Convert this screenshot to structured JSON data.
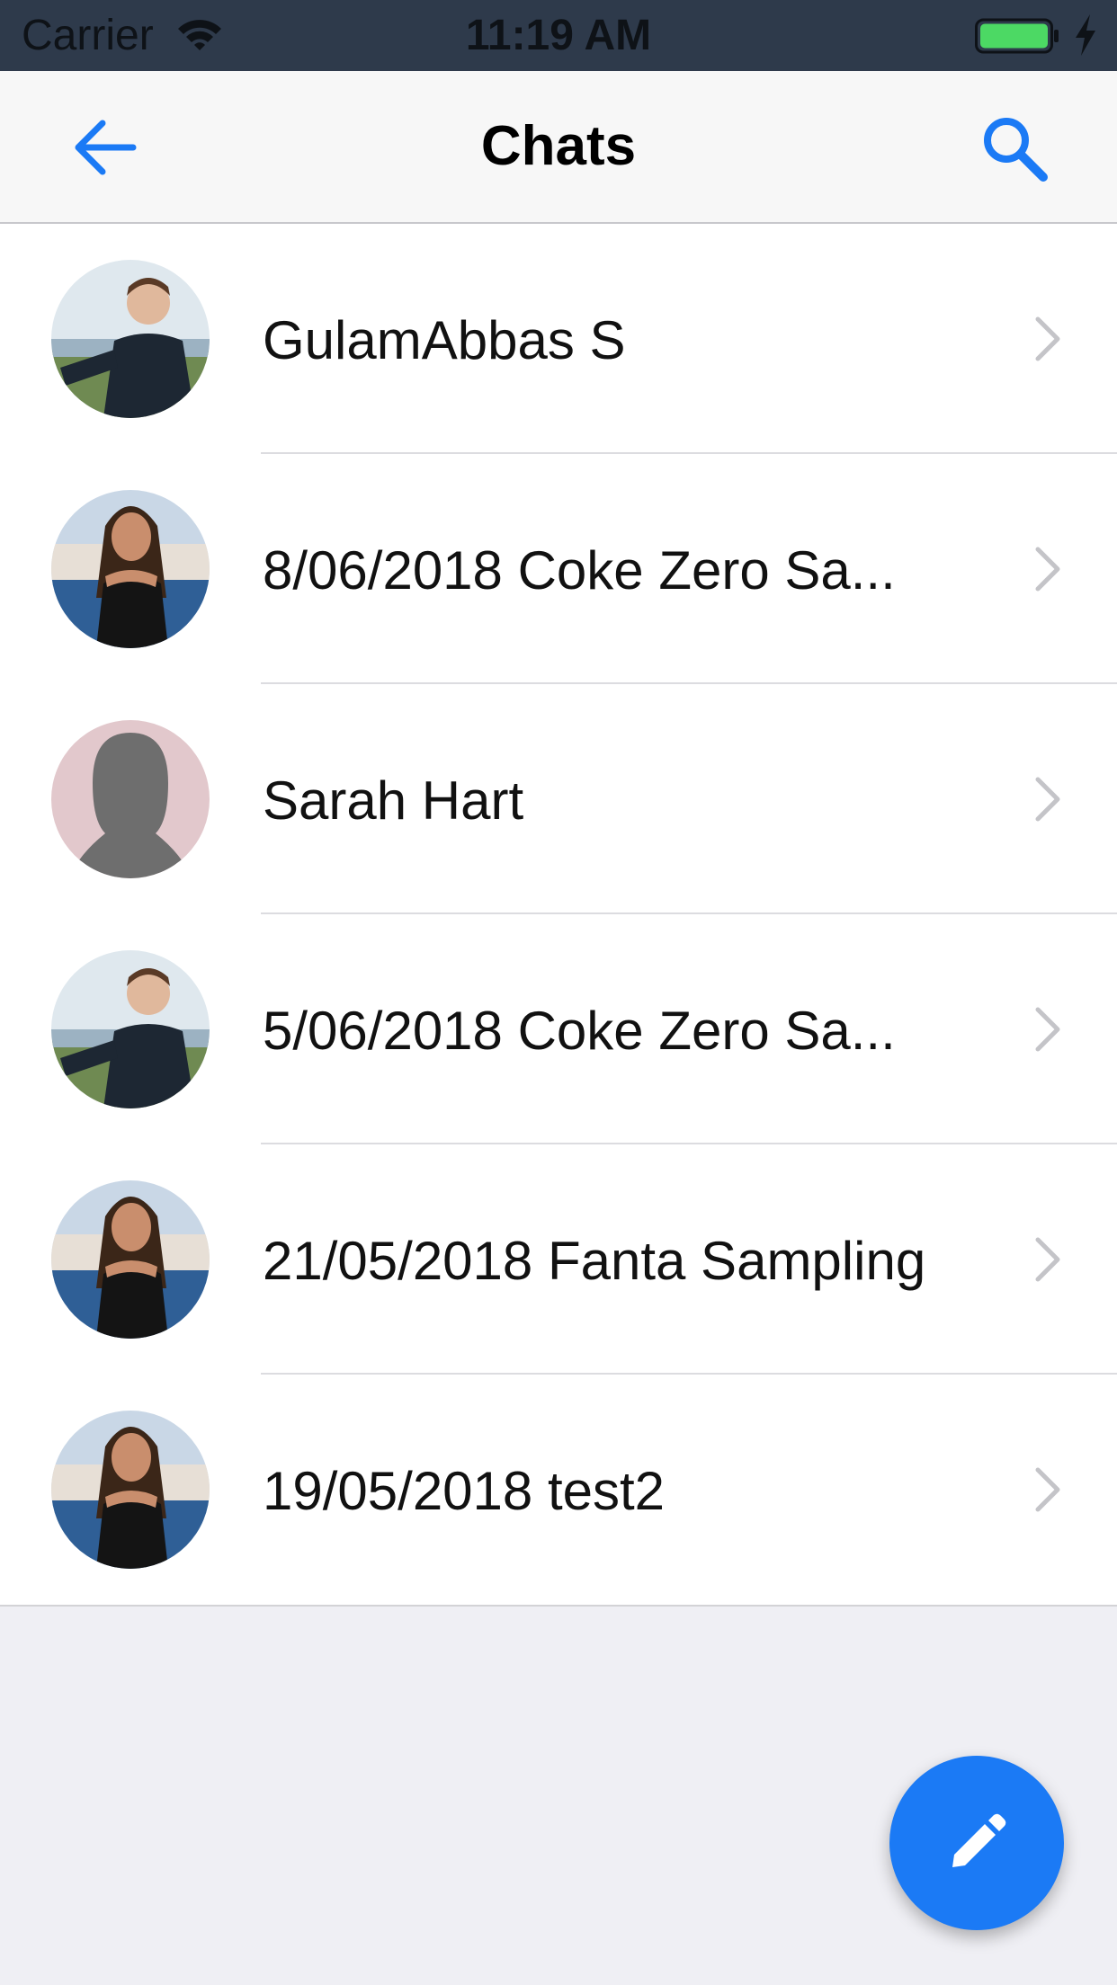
{
  "status_bar": {
    "carrier": "Carrier",
    "time": "11:19 AM",
    "battery_color": "#4cd964"
  },
  "nav": {
    "title": "Chats",
    "back_icon": "arrow-left-icon",
    "search_icon": "search-icon",
    "accent_color": "#1b7af5"
  },
  "chats": [
    {
      "title": "GulamAbbas S",
      "avatar": "male-photo"
    },
    {
      "title": "8/06/2018 Coke Zero Sa...",
      "avatar": "female-photo"
    },
    {
      "title": "Sarah Hart",
      "avatar": "silhouette-placeholder"
    },
    {
      "title": "5/06/2018 Coke Zero Sa...",
      "avatar": "male-photo"
    },
    {
      "title": "21/05/2018 Fanta Sampling",
      "avatar": "female-photo"
    },
    {
      "title": "19/05/2018 test2",
      "avatar": "female-photo"
    }
  ],
  "fab": {
    "icon": "pencil-icon",
    "color": "#1b7af5"
  }
}
